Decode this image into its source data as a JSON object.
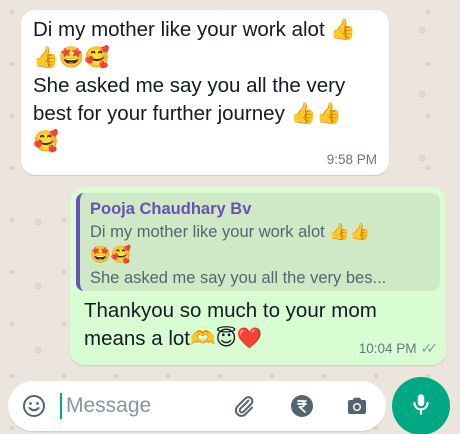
{
  "incoming": {
    "lines": [
      "Di my mother like your work alot 👍",
      "👍🤩🥰",
      "She asked me say you all the very",
      "best for your further journey 👍👍",
      "🥰"
    ],
    "time": "9:58 PM"
  },
  "outgoing": {
    "quote": {
      "author": "Pooja Chaudhary Bv",
      "lines": [
        "Di my mother like your work alot 👍👍",
        "🤩🥰",
        "She asked me say you all the very bes..."
      ]
    },
    "lines": [
      "Thankyou so much to your mom",
      "means a lot🫶😇❤️"
    ],
    "time": "10:04 PM",
    "status": "read",
    "status_ticks": "✓✓"
  },
  "composer": {
    "placeholder": "Message",
    "icons": [
      "emoji-icon",
      "attach-icon",
      "rupee-icon",
      "camera-icon",
      "mic-icon"
    ]
  },
  "colors": {
    "accent": "#00a884",
    "outgoing_bubble": "#d9fdd3",
    "incoming_bubble": "#ffffff",
    "quote_author": "#6a4fb7",
    "wallpaper": "#ece5dd"
  }
}
